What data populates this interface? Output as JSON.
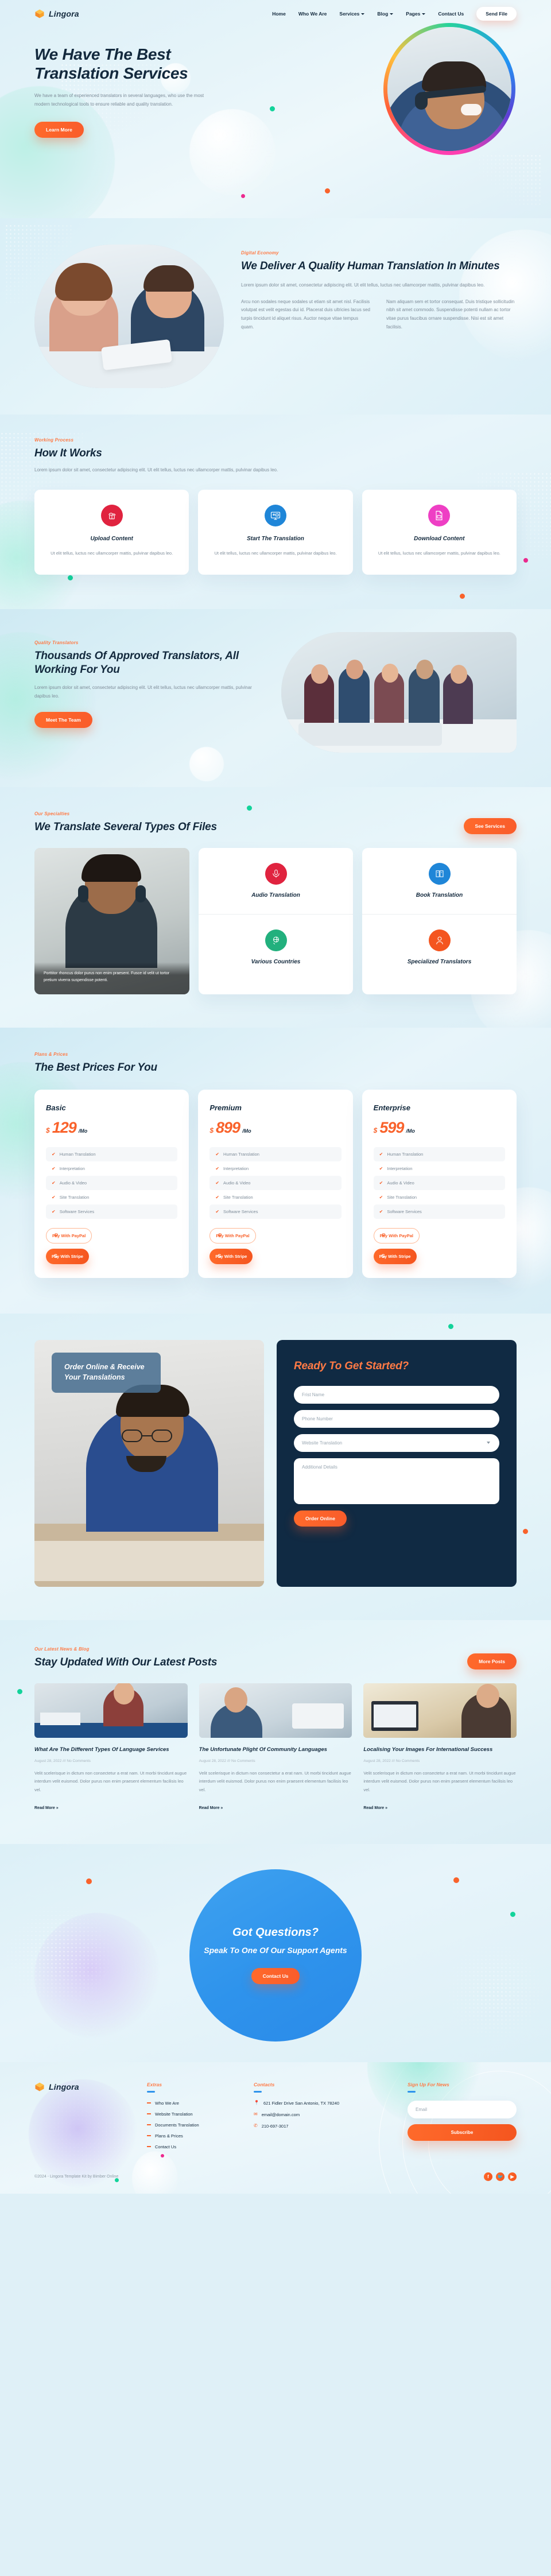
{
  "brand": {
    "name": "Lingora",
    "logo_icon": "orange-cube-logo"
  },
  "nav": {
    "items": [
      {
        "label": "Home",
        "has_dropdown": false
      },
      {
        "label": "Who We Are",
        "has_dropdown": false
      },
      {
        "label": "Services",
        "has_dropdown": true
      },
      {
        "label": "Blog",
        "has_dropdown": true
      },
      {
        "label": "Pages",
        "has_dropdown": true
      },
      {
        "label": "Contact Us",
        "has_dropdown": false
      }
    ],
    "cta_label": "Send File"
  },
  "hero": {
    "title": "We Have The Best Translation Services",
    "paragraph": "We have a team of experienced translators in several languages, who use the most modern technological tools to ensure reliable and quality translation.",
    "cta_label": "Learn More"
  },
  "deliver": {
    "eyebrow": "Digital Economy",
    "title": "We Deliver A Quality Human Translation In Minutes",
    "lead": "Lorem ipsum dolor sit amet, consectetur adipiscing elit. Ut elit tellus, luctus nec ullamcorper mattis, pulvinar dapibus leo.",
    "col1": "Arcu non sodales neque sodales ut etiam sit amet nisl. Facilisis volutpat est velit egestas dui id. Placerat duis ultricies lacus sed turpis tincidunt id aliquet risus. Auctor neque vitae tempus quam.",
    "col2": "Nam aliquam sem et tortor consequat. Duis tristique sollicitudin nibh sit amet commodo. Suspendisse potenti nullam ac tortor vitae purus faucibus ornare suspendisse. Nisi est sit amet facilisis."
  },
  "works": {
    "eyebrow": "Working Process",
    "title": "How It Works",
    "paragraph": "Lorem ipsum dolor sit amet, consectetur adipiscing elit. Ut elit tellus, luctus nec ullamcorper mattis, pulvinar dapibus leo.",
    "cards": [
      {
        "icon": "cloud-upload-book-icon",
        "color": "#e0233f",
        "title": "Upload Content",
        "text": "Ut elit tellus, luctus nec ullamcorper mattis, pulvinar dapibus leo."
      },
      {
        "icon": "monitor-chat-icon",
        "color": "#1f86d8",
        "title": "Start The Translation",
        "text": "Ut elit tellus, luctus nec ullamcorper mattis, pulvinar dapibus leo."
      },
      {
        "icon": "pdf-download-icon",
        "color": "#ee3fc4",
        "title": "Download Content",
        "text": "Ut elit tellus, luctus nec ullamcorper mattis, pulvinar dapibus leo."
      }
    ]
  },
  "translators": {
    "eyebrow": "Quality Translators",
    "title": "Thousands Of Approved Translators, All Working For You",
    "paragraph": "Lorem ipsum dolor sit amet, consectetur adipiscing elit. Ut elit tellus, luctus nec ullamcorper mattis, pulvinar dapibus leo.",
    "cta_label": "Meet The Team"
  },
  "specialties": {
    "eyebrow": "Our Specialties",
    "title": "We Translate Several Types Of Files",
    "cta_label": "See Services",
    "photo_caption": "Porttitor rhoncus dolor purus non enim praesent. Fusce id velit ut tortor pretium viverra suspendisse potenti.",
    "items": [
      {
        "icon": "audio-wave-icon",
        "color": "#e0233f",
        "title": "Audio Translation"
      },
      {
        "icon": "book-icon",
        "color": "#1f86d8",
        "title": "Book Translation"
      },
      {
        "icon": "globe-hand-icon",
        "color": "#22b07d",
        "title": "Various Countries"
      },
      {
        "icon": "person-tie-icon",
        "color": "#f4551f",
        "title": "Specialized Translators"
      }
    ]
  },
  "pricing": {
    "eyebrow": "Plans & Prices",
    "title": "The Best Prices For You",
    "currency": "$",
    "period": "/Mo",
    "paypal_label": "Pay With PayPal",
    "stripe_label": "Pay With Stripe",
    "paypal_icon": "P",
    "stripe_icon": "S",
    "plans": [
      {
        "name": "Basic",
        "amount": "129",
        "features": [
          "Human Translation",
          "Interpretation",
          "Audio & Video",
          "Site Translation",
          "Software Services"
        ]
      },
      {
        "name": "Premium",
        "amount": "899",
        "features": [
          "Human Translation",
          "Interpretation",
          "Audio & Video",
          "Site Translation",
          "Software Services"
        ]
      },
      {
        "name": "Enterprise",
        "amount": "599",
        "features": [
          "Human Translation",
          "Interpretation",
          "Audio & Video",
          "Site Translation",
          "Software Services"
        ]
      }
    ]
  },
  "order": {
    "badge_title": "Order Online & Receive Your Translations",
    "form_title": "Ready To Get Started?",
    "fields": {
      "first_name": "Frist Name",
      "phone": "Phone Number",
      "service": "Website Translation",
      "details": "Additional Details"
    },
    "submit_label": "Order Online"
  },
  "blog": {
    "eyebrow": "Our Latest News & Blog",
    "title": "Stay Updated With Our Latest Posts",
    "cta_label": "More Posts",
    "read_more_label": "Read More »",
    "posts": [
      {
        "title": "What Are The Different Types Of Language Services",
        "meta": "August 28, 2022 /// No Comments",
        "excerpt": "Velit scelerisque in dictum non consectetur a erat nam. Ut morbi tincidunt augue interdum velit euismod. Dolor purus non enim praesent elementum facilisis leo vel."
      },
      {
        "title": "The Unfortunate Plight Of Community Languages",
        "meta": "August 28, 2022 /// No Comments",
        "excerpt": "Velit scelerisque in dictum non consectetur a erat nam. Ut morbi tincidunt augue interdum velit euismod. Dolor purus non enim praesent elementum facilisis leo vel."
      },
      {
        "title": "Localising Your Images For International Success",
        "meta": "August 28, 2022 /// No Comments",
        "excerpt": "Velit scelerisque in dictum non consectetur a erat nam. Ut morbi tincidunt augue interdum velit euismod. Dolor purus non enim praesent elementum facilisis leo vel."
      }
    ]
  },
  "cta": {
    "title": "Got Questions?",
    "subtitle": "Speak To One Of Our Support Agents",
    "button_label": "Contact Us",
    "circle_color": "#2e93ec"
  },
  "footer": {
    "extras_title": "Extras",
    "extras": [
      "Who We Are",
      "Website Translation",
      "Documents Translation",
      "Plans & Prices",
      "Contact Us"
    ],
    "contacts_title": "Contacts",
    "contacts": [
      {
        "icon": "location-pin-icon",
        "text": "621 Fidler Drive San Antonio, TX 78240"
      },
      {
        "icon": "envelope-icon",
        "text": "email@domain.com"
      },
      {
        "icon": "phone-icon",
        "text": "210-697-3017"
      }
    ],
    "news_title": "Sign Up For News",
    "email_placeholder": "Email",
    "subscribe_label": "Subscribe",
    "copyright": "©2024 - Lingora Template Kit by Bimber Online",
    "socials": [
      {
        "icon": "facebook-icon",
        "glyph": "f"
      },
      {
        "icon": "twitter-icon",
        "glyph": "🐦"
      },
      {
        "icon": "youtube-icon",
        "glyph": "▶"
      }
    ]
  },
  "colors": {
    "accent": "#f9622b",
    "dark": "#13293d",
    "blue": "#2e93ec",
    "bg": "#dff0f7"
  }
}
